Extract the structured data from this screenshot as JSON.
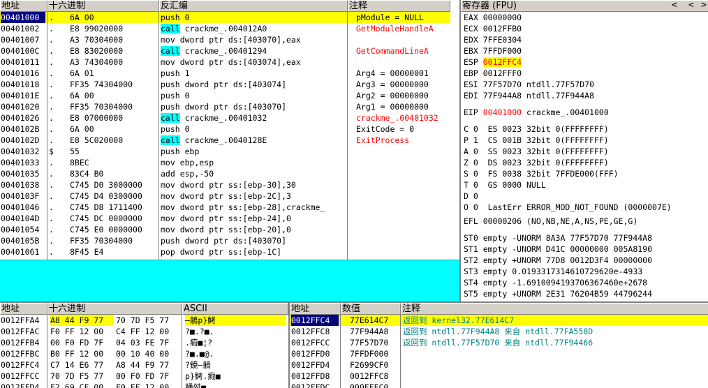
{
  "cpu": {
    "headers": {
      "addr": "地址",
      "hex": "十六进制",
      "disasm": "反汇编",
      "comment": "注释"
    },
    "rows": [
      {
        "addr": "00401000",
        "mark": ".",
        "hex": "6A 00",
        "disasm": "push 0",
        "comment": "pModule = NULL",
        "comment_color": "#000000",
        "selected": true
      },
      {
        "addr": "00401002",
        "mark": ".",
        "hex": "E8 99020000",
        "kw": "call",
        "disasm": " crackme_.004012A0",
        "comment": "GetModuleHandleA",
        "comment_color": "#ff0000"
      },
      {
        "addr": "00401007",
        "mark": ".",
        "hex": "A3 70304000",
        "disasm": "mov dword ptr ds:[403070],eax",
        "comment": ""
      },
      {
        "addr": "0040100C",
        "mark": ".",
        "hex": "E8 83020000",
        "kw": "call",
        "disasm": " crackme_.00401294",
        "comment": "GetCommandLineA",
        "comment_color": "#ff0000"
      },
      {
        "addr": "00401011",
        "mark": ".",
        "hex": "A3 74304000",
        "disasm": "mov dword ptr ds:[403074],eax",
        "comment": ""
      },
      {
        "addr": "00401016",
        "mark": ".",
        "hex": "6A 01",
        "disasm": "push 1",
        "comment": "Arg4 = 00000001",
        "comment_color": "#000000"
      },
      {
        "addr": "00401018",
        "mark": ".",
        "hex": "FF35 74304000",
        "disasm": "push dword ptr ds:[403074]",
        "comment": "Arg3 = 00000000",
        "comment_color": "#000000"
      },
      {
        "addr": "0040101E",
        "mark": ".",
        "hex": "6A 00",
        "disasm": "push 0",
        "comment": "Arg2 = 00000000",
        "comment_color": "#000000"
      },
      {
        "addr": "00401020",
        "mark": ".",
        "hex": "FF35 70304000",
        "disasm": "push dword ptr ds:[403070]",
        "comment": "Arg1 = 00000000",
        "comment_color": "#000000"
      },
      {
        "addr": "00401026",
        "mark": ".",
        "hex": "E8 07000000",
        "kw": "call",
        "disasm": " crackme_.00401032",
        "comment": "crackme_.00401032",
        "comment_color": "#ff0000"
      },
      {
        "addr": "0040102B",
        "mark": ".",
        "hex": "6A 00",
        "disasm": "push 0",
        "comment": "ExitCode = 0",
        "comment_color": "#000000"
      },
      {
        "addr": "0040102D",
        "mark": ".",
        "hex": "E8 5C020000",
        "kw": "call",
        "disasm": " crackme_.0040128E",
        "comment": "ExitProcess",
        "comment_color": "#ff0000"
      },
      {
        "addr": "00401032",
        "mark": "$",
        "hex": "55",
        "disasm": "push ebp",
        "comment": ""
      },
      {
        "addr": "00401033",
        "mark": ".",
        "hex": "8BEC",
        "disasm": "mov ebp,esp",
        "comment": ""
      },
      {
        "addr": "00401035",
        "mark": ".",
        "hex": "83C4 B0",
        "disasm": "add esp,-50",
        "comment": ""
      },
      {
        "addr": "00401038",
        "mark": ".",
        "hex": "C745 D0 3000000",
        "disasm": "mov dword ptr ss:[ebp-30],30",
        "comment": ""
      },
      {
        "addr": "0040103F",
        "mark": ".",
        "hex": "C745 D4 0300000",
        "disasm": "mov dword ptr ss:[ebp-2C],3",
        "comment": ""
      },
      {
        "addr": "00401046",
        "mark": ".",
        "hex": "C745 D8 1711400",
        "disasm": "mov dword ptr ss:[ebp-28],crackme_",
        "comment": ""
      },
      {
        "addr": "0040104D",
        "mark": ".",
        "hex": "C745 DC 0000000",
        "disasm": "mov dword ptr ss:[ebp-24],0",
        "comment": ""
      },
      {
        "addr": "00401054",
        "mark": ".",
        "hex": "C745 E0 0000000",
        "disasm": "mov dword ptr ss:[ebp-20],0",
        "comment": ""
      },
      {
        "addr": "0040105B",
        "mark": ".",
        "hex": "FF35 70304000",
        "disasm": "push dword ptr ds:[403070]",
        "comment": ""
      },
      {
        "addr": "00401061",
        "mark": ".",
        "hex": "8F45 E4",
        "disasm": "pop dword ptr ss:[ebp-1C]",
        "comment": ""
      }
    ]
  },
  "registers": {
    "title": "寄存器 (FPU)",
    "nav": [
      "<",
      "<",
      ">"
    ],
    "gp": [
      {
        "name": "EAX",
        "value": "00000000",
        "extra": ""
      },
      {
        "name": "ECX",
        "value": "0012FFB0",
        "extra": ""
      },
      {
        "name": "EDX",
        "value": "7FFE0304",
        "extra": ""
      },
      {
        "name": "EBX",
        "value": "7FFDF000",
        "extra": ""
      },
      {
        "name": "ESP",
        "value": "0012FFC4",
        "extra": "",
        "changed": true
      },
      {
        "name": "EBP",
        "value": "0012FFF0",
        "extra": ""
      },
      {
        "name": "ESI",
        "value": "77F57D70",
        "extra": "ntdll.77F57D70"
      },
      {
        "name": "EDI",
        "value": "77F944A8",
        "extra": "ntdll.77F944A8"
      }
    ],
    "eip": {
      "name": "EIP",
      "value": "00401000",
      "extra": "crackme_.00401000"
    },
    "flags": [
      "C 0  ES 0023 32bit 0(FFFFFFFF)",
      "P 1  CS 001B 32bit 0(FFFFFFFF)",
      "A 0  SS 0023 32bit 0(FFFFFFFF)",
      "Z 0  DS 0023 32bit 0(FFFFFFFF)",
      "S 0  FS 0038 32bit 7FFDE000(FFF)",
      "T 0  GS 0000 NULL",
      "D 0",
      "O 0  LastErr ERROR_MOD_NOT_FOUND (0000007E)"
    ],
    "efl": "EFL 00000206 (NO,NB,NE,A,NS,PE,GE,G)",
    "fpu": [
      "ST0 empty -UNORM 8A3A 77F57D70 77F944A8",
      "ST1 empty -UNORM D41C 00000000 005A8190",
      "ST2 empty +UNORM 77D8 0012D3F4 00000000",
      "ST3 empty 0.0193317314610729620e-4933",
      "ST4 empty -1.6910094193706367460e+2678",
      "ST5 empty +UNORM 2E31 76204B59 44796244"
    ]
  },
  "dump": {
    "headers": {
      "addr": "地址",
      "hex": "十六进制",
      "ascii": "ASCII"
    },
    "rows": [
      {
        "addr": "0012FFA4",
        "hex1": "A8 44 F9 77",
        "hex2": "70 7D F5 77",
        "ascii": "―鵢p}鮳",
        "selected": true
      },
      {
        "addr": "0012FFAC",
        "hex1": "F0 FF 12 00",
        "hex2": "C4 FF 12 00",
        "ascii": "?■.?■."
      },
      {
        "addr": "0012FFB4",
        "hex1": "00 F0 FD 7F",
        "hex2": "04 03 FE 7F",
        "ascii": ".瘕■¦?"
      },
      {
        "addr": "0012FFBC",
        "hex1": "B0 FF 12 00",
        "hex2": "00 10 40 00",
        "ascii": "?■.■@."
      },
      {
        "addr": "0012FFC4",
        "hex1": "C7 14 E6 77",
        "hex2": "A8 44 F9 77",
        "ascii": "?鏡―鵢"
      },
      {
        "addr": "0012FFCC",
        "hex1": "70 7D F5 77",
        "hex2": "00 F0 FD 7F",
        "ascii": "p}鮳.瘕■"
      },
      {
        "addr": "0012FFD4",
        "hex1": "F2 69 CF 00",
        "hex2": "F0 FF 12 00",
        "ascii": "踴舛■."
      }
    ]
  },
  "stack": {
    "headers": {
      "addr": "地址",
      "value": "数值",
      "comment": "注释"
    },
    "rows": [
      {
        "addr": "0012FFC4",
        "value": "77E614C7",
        "comment": "返回到 kernel32.77E614C7",
        "selected": true
      },
      {
        "addr": "0012FFC8",
        "value": "77F944A8",
        "comment": "返回到 ntdll.77F944A8 来自 ntdll.77FA558D"
      },
      {
        "addr": "0012FFCC",
        "value": "77F57D70",
        "comment": "返回到 ntdll.77F57D70 来自 ntdll.77F94466"
      },
      {
        "addr": "0012FFD0",
        "value": "7FFDF000",
        "comment": ""
      },
      {
        "addr": "0012FFD4",
        "value": "F2699CF0",
        "comment": ""
      },
      {
        "addr": "0012FFD8",
        "value": "0012FFC8",
        "comment": ""
      },
      {
        "addr": "0012FFDC",
        "value": "000FFEC0",
        "comment": ""
      }
    ]
  }
}
